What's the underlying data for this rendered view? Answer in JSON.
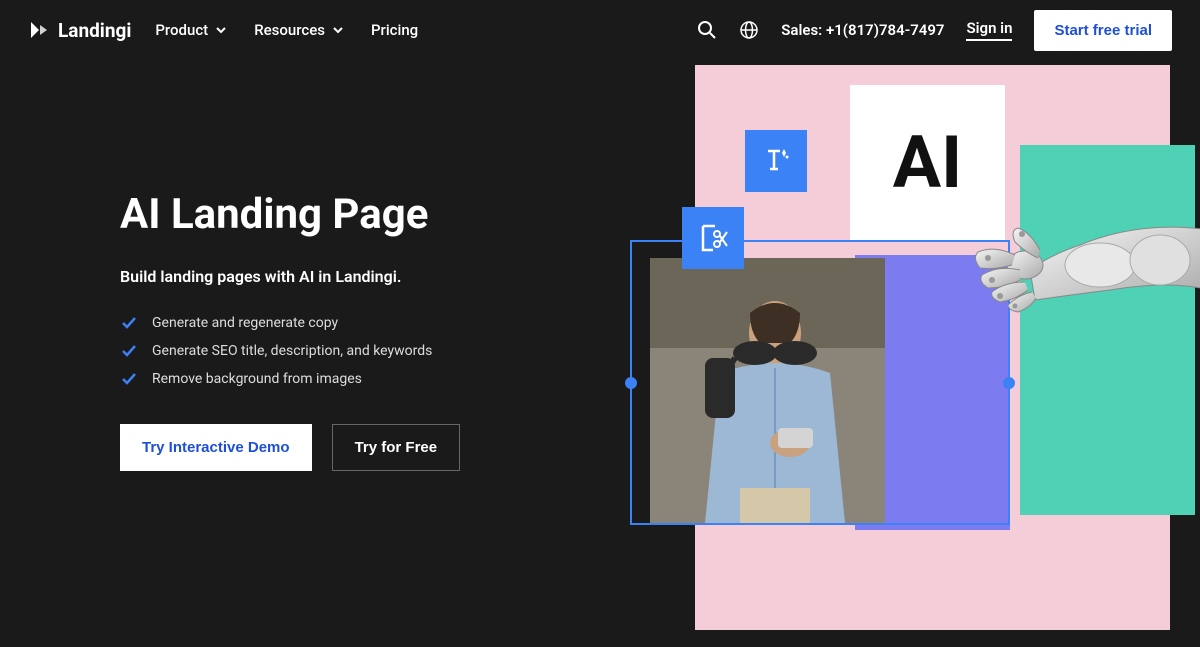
{
  "header": {
    "brand": "Landingi",
    "nav": [
      {
        "label": "Product",
        "has_dropdown": true
      },
      {
        "label": "Resources",
        "has_dropdown": true
      },
      {
        "label": "Pricing",
        "has_dropdown": false
      }
    ],
    "sales": "Sales: +1(817)784-7497",
    "signin": "Sign in",
    "cta": "Start free trial"
  },
  "hero": {
    "title": "AI Landing Page",
    "subtitle": "Build landing pages with AI in Landingi.",
    "features": [
      "Generate and regenerate copy",
      "Generate SEO title, description, and keywords",
      "Remove background from images"
    ],
    "primary_btn": "Try Interactive Demo",
    "secondary_btn": "Try for Free",
    "ai_label": "AI"
  }
}
